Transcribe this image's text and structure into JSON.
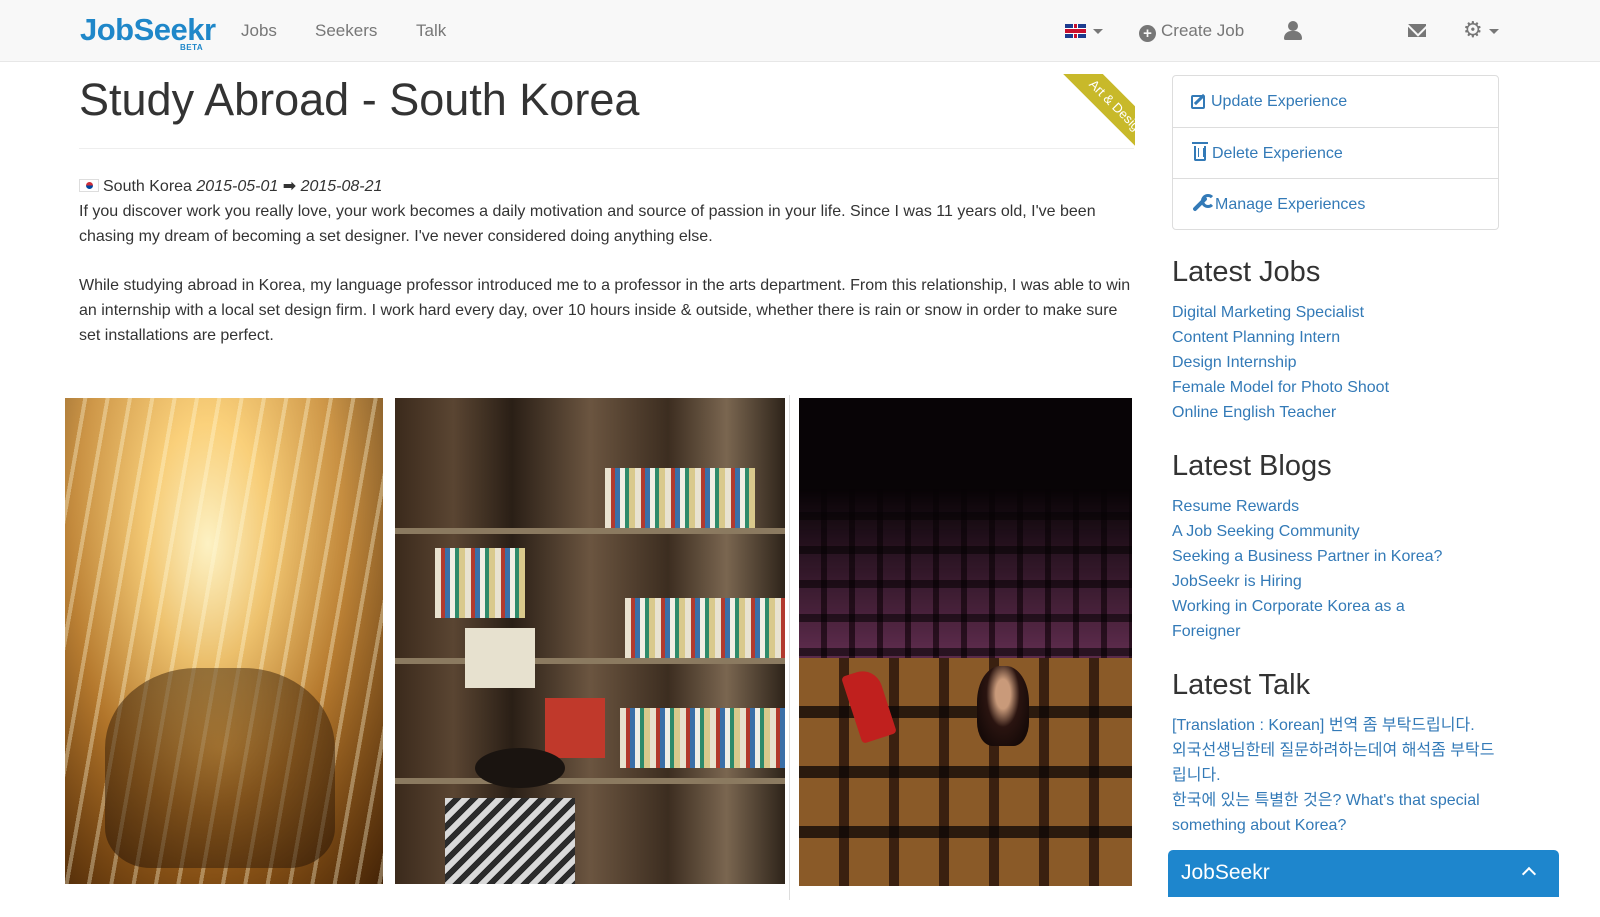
{
  "brand": {
    "name_part1": "Job",
    "name_part2": "Seekr",
    "badge": "BETA"
  },
  "nav": {
    "links": [
      "Jobs",
      "Seekers",
      "Talk"
    ],
    "create_job": "Create Job"
  },
  "experience": {
    "title": "Study Abroad - South Korea",
    "category_ribbon": "Art & Design",
    "country": "South Korea",
    "start_date": "2015-05-01",
    "end_date": "2015-08-21",
    "paragraph_1": "If you discover work you really love, your work becomes a daily motivation and source of passion in your life. Since I was 11 years old, I've been chasing my dream of becoming a set designer. I've never considered doing anything else.",
    "paragraph_2": "While studying abroad in Korea, my language professor introduced me to a professor in the arts department. From this relationship, I was able to win an internship with a local set design firm. I work hard every day, over 10 hours inside & outside, whether there is rain or snow in order to make sure set installations are perfect."
  },
  "actions": {
    "update": "Update Experience",
    "delete": "Delete Experience",
    "manage": "Manage Experiences"
  },
  "latest_jobs": {
    "heading": "Latest Jobs",
    "items": [
      "Digital Marketing Specialist",
      "Content Planning Intern",
      "Design Internship",
      "Female Model for Photo Shoot",
      "Online English Teacher"
    ]
  },
  "latest_blogs": {
    "heading": "Latest Blogs",
    "items": [
      "Resume Rewards",
      "A Job Seeking Community",
      "Seeking a Business Partner in Korea?",
      "JobSeekr is Hiring",
      "Working in Corporate Korea as a Foreigner"
    ]
  },
  "latest_talk": {
    "heading": "Latest Talk",
    "items": [
      "[Translation : Korean] 번역 좀 부탁드립니다.",
      "외국선생님한테 질문하려하는데여 해석좀 부탁드립니다.",
      "한국에 있는 특별한 것은? What's that special something about Korea?"
    ]
  },
  "chat": {
    "title": "JobSeekr"
  },
  "colors": {
    "link": "#337ab7",
    "brand": "#1f87c9",
    "ribbon": "#c8b92a",
    "chat_bar": "#1e86cd"
  }
}
